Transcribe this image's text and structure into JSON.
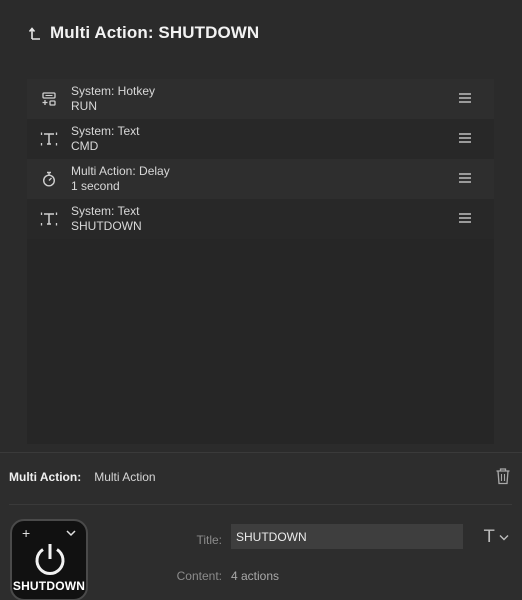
{
  "header": {
    "title": "Multi Action: SHUTDOWN",
    "back_icon": "back-arrow-icon"
  },
  "actions": [
    {
      "title": "System: Hotkey",
      "subtitle": "RUN",
      "icon": "hotkey-icon"
    },
    {
      "title": "System: Text",
      "subtitle": "CMD",
      "icon": "text-icon"
    },
    {
      "title": "Multi Action: Delay",
      "subtitle": "1 second",
      "icon": "stopwatch-icon"
    },
    {
      "title": "System: Text",
      "subtitle": "SHUTDOWN",
      "icon": "text-icon"
    }
  ],
  "bottom": {
    "type_label": "Multi Action:",
    "type_value": "Multi Action",
    "key": {
      "label": "SHUTDOWN",
      "plus": "+",
      "icon": "power-icon"
    },
    "title_label": "Title:",
    "title_value": "SHUTDOWN",
    "font_button": "T",
    "content_label": "Content:",
    "content_value": "4 actions"
  },
  "colors": {
    "background": "#2b2b2b",
    "panel": "#262626",
    "row_alt": "#2e2e2e",
    "input": "#3e3e3e"
  }
}
